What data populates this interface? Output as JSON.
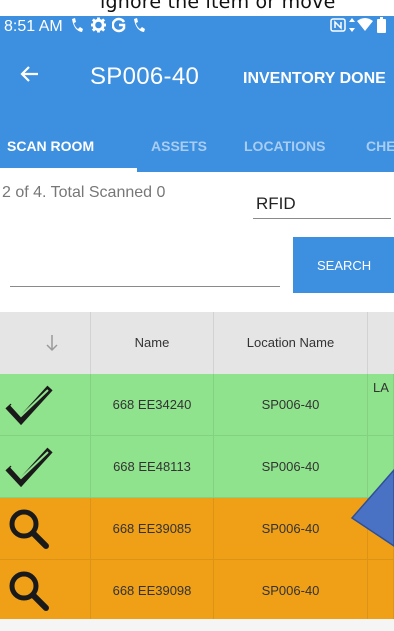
{
  "caption_text": "ignore the item or move",
  "status_bar": {
    "time": "8:51 AM",
    "icons": [
      "phone-icon",
      "gear-icon",
      "google-icon",
      "phone-icon",
      "nfc-icon",
      "data-arrows-icon",
      "wifi-icon",
      "battery-icon"
    ]
  },
  "app_bar": {
    "back_icon": "back-arrow-icon",
    "title": "SP006-40",
    "action_label": "INVENTORY DONE",
    "color": "#3d8fe0"
  },
  "tabs": [
    {
      "label": "SCAN ROOM",
      "active": true
    },
    {
      "label": "ASSETS",
      "active": false
    },
    {
      "label": "LOCATIONS",
      "active": false
    },
    {
      "label": "CHE",
      "active": false
    }
  ],
  "scan_info": "2 of 4. Total Scanned 0",
  "rfid_field": {
    "value": "RFID"
  },
  "search_field": {
    "value": ""
  },
  "search_button_label": "SEARCH",
  "grid": {
    "sort_icon": "sort-down-arrow-icon",
    "columns": [
      "Name",
      "Location Name"
    ],
    "rows": [
      {
        "status_icon": "checkmark-icon",
        "name": "668 EE34240",
        "location": "SP006-40",
        "extra": "LA",
        "bg": "#8fe38c"
      },
      {
        "status_icon": "checkmark-icon",
        "name": "668 EE48113",
        "location": "SP006-40",
        "extra": "",
        "bg": "#8fe38c"
      },
      {
        "status_icon": "magnifier-icon",
        "name": "668 EE39085",
        "location": "SP006-40",
        "extra": "",
        "bg": "#f0a017"
      },
      {
        "status_icon": "magnifier-icon",
        "name": "668 EE39098",
        "location": "SP006-40",
        "extra": "",
        "bg": "#f0a017"
      }
    ]
  }
}
